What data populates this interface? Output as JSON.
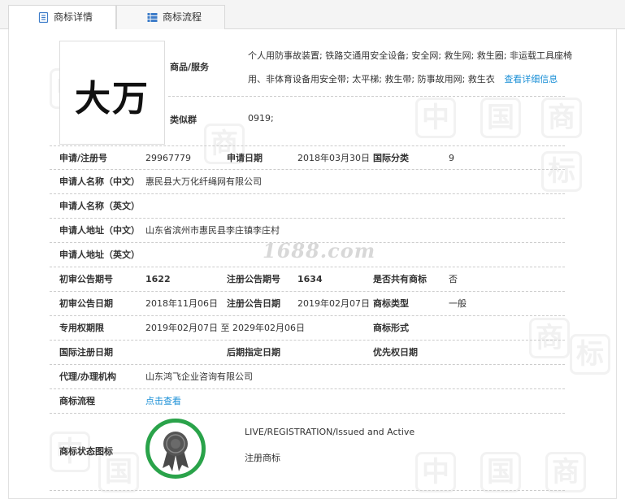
{
  "tabs": [
    {
      "label": "商标详情",
      "icon": "document-icon"
    },
    {
      "label": "商标流程",
      "icon": "list-icon"
    }
  ],
  "watermark": {
    "chars": [
      "中",
      "国",
      "商",
      "标"
    ],
    "site": "1688.com"
  },
  "logo": {
    "text": "大万"
  },
  "goods": {
    "label": "商品/服务",
    "value_line1": "个人用防事故装置; 铁路交通用安全设备; 安全网; 救生网; 救生圈; 非运载工具座椅",
    "value_line2": "用、非体育设备用安全带; 太平梯; 救生带; 防事故用网; 救生衣",
    "link": "查看详细信息"
  },
  "group": {
    "label": "类似群",
    "value": "0919;"
  },
  "rows": [
    {
      "l1": "申请/注册号",
      "v1": "29967779",
      "l2": "申请日期",
      "v2": "2018年03月30日",
      "l3": "国际分类",
      "v3": "9"
    },
    {
      "l1": "申请人名称（中文）",
      "v1": "惠民县大万化纤绳网有限公司"
    },
    {
      "l1": "申请人名称（英文）",
      "v1": ""
    },
    {
      "l1": "申请人地址（中文）",
      "v1": "山东省滨州市惠民县李庄镇李庄村"
    },
    {
      "l1": "申请人地址（英文）",
      "v1": ""
    },
    {
      "l1": "初审公告期号",
      "v1": "1622",
      "l2": "注册公告期号",
      "v2": "1634",
      "l3": "是否共有商标",
      "v3": "否"
    },
    {
      "l1": "初审公告日期",
      "v1": "2018年11月06日",
      "l2": "注册公告日期",
      "v2": "2019年02月07日",
      "l3": "商标类型",
      "v3": "一般"
    },
    {
      "l1": "专用权期限",
      "v1": "2019年02月07日 至 2029年02月06日",
      "l3": "商标形式",
      "v3": ""
    },
    {
      "l1": "国际注册日期",
      "v1": "",
      "l2": "后期指定日期",
      "v2": "",
      "l3": "优先权日期",
      "v3": ""
    },
    {
      "l1": "代理/办理机构",
      "v1": "山东鸿飞企业咨询有限公司"
    },
    {
      "l1": "商标流程",
      "v1": "点击查看"
    }
  ],
  "status": {
    "label": "商标状态图标",
    "en": "LIVE/REGISTRATION/Issued and Active",
    "cn": "注册商标"
  },
  "colors": {
    "link": "#1a8fd6",
    "badge_ring": "#2aa34a",
    "badge_fill": "#555555"
  }
}
